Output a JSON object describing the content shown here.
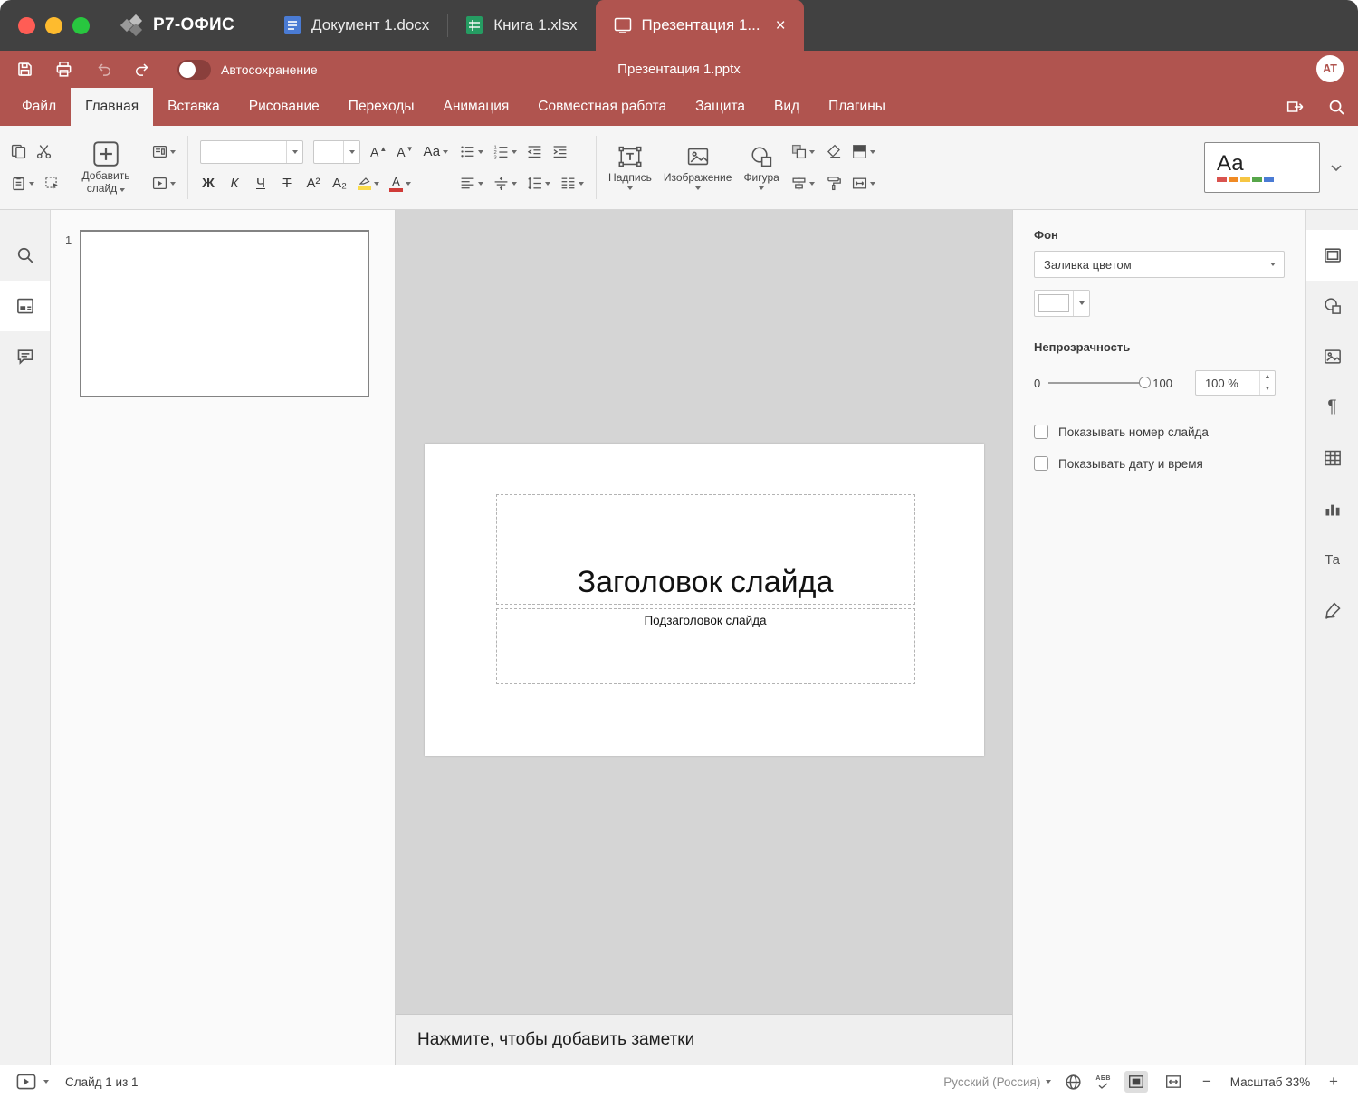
{
  "colors": {
    "accent": "#b0544f",
    "chrome_bar": "#414141",
    "traffic_close": "#ff5d55",
    "traffic_min": "#febb2e",
    "traffic_max": "#28c73f",
    "doc_tab_icon": "#4a7bd4",
    "sheet_tab_icon": "#259c62",
    "canvas_bg": "#d5d5d5",
    "theme_stripe_1": "#d9534f",
    "theme_stripe_2": "#f08a24",
    "theme_stripe_3": "#f6c643",
    "theme_stripe_4": "#57a64a",
    "theme_stripe_5": "#4a7bd4",
    "highlight_bar": "#fadb4a",
    "font_color_bar": "#d03b38"
  },
  "chrome": {
    "app_name": "Р7-ОФИС",
    "tabs": [
      {
        "label": "Документ 1.docx",
        "type": "document"
      },
      {
        "label": "Книга 1.xlsx",
        "type": "spreadsheet"
      },
      {
        "label": "Презентация 1...",
        "type": "presentation",
        "active": true,
        "close_glyph": "×"
      }
    ]
  },
  "titlebar": {
    "autosave_label": "Автосохранение",
    "autosave_on": false,
    "document_title": "Презентация 1.pptx",
    "avatar_initials": "AT"
  },
  "menubar": {
    "items": [
      {
        "label": "Файл"
      },
      {
        "label": "Главная"
      },
      {
        "label": "Вставка"
      },
      {
        "label": "Рисование"
      },
      {
        "label": "Переходы"
      },
      {
        "label": "Анимация"
      },
      {
        "label": "Совместная работа"
      },
      {
        "label": "Защита"
      },
      {
        "label": "Вид"
      },
      {
        "label": "Плагины"
      }
    ],
    "active_item": "Главная"
  },
  "toolbar": {
    "add_slide_label": "Добавить слайд",
    "font_family_value": "",
    "font_size_value": "",
    "bold": "Ж",
    "italic": "К",
    "underline": "Ч",
    "strikethrough": "Т",
    "superscript": "А²",
    "subscript": "А₂",
    "font_color_letter": "А",
    "change_case": "Аа",
    "textbox_label": "Надпись",
    "image_label": "Изображение",
    "shape_label": "Фигура",
    "theme_preview": "Аа"
  },
  "slides_panel": {
    "slide_number": "1"
  },
  "slide": {
    "title_placeholder": "Заголовок слайда",
    "subtitle_placeholder": "Подзаголовок слайда"
  },
  "notes": {
    "placeholder": "Нажмите, чтобы добавить заметки"
  },
  "background_panel": {
    "title": "Фон",
    "fill_type_value": "Заливка цветом",
    "swatch_color": "#ffffff",
    "opacity_label": "Непрозрачность",
    "opacity_min": "0",
    "opacity_max": "100",
    "opacity_value": "100 %",
    "checkbox_slide_number": "Показывать номер слайда",
    "checkbox_slide_number_checked": false,
    "checkbox_date_time": "Показывать дату и время",
    "checkbox_date_time_checked": false
  },
  "statusbar": {
    "slide_counter": "Слайд 1 из 1",
    "language": "Русский (Россия)",
    "spellcheck_glyph": "АБВ",
    "zoom_label": "Масштаб 33%"
  },
  "icons": {
    "paragraph_glyph": "¶",
    "textart_glyph": "Та",
    "named": [
      "save-icon",
      "print-icon",
      "undo-icon",
      "redo-icon",
      "copy-icon",
      "cut-icon",
      "paste-icon",
      "select-icon",
      "add-slide-icon",
      "slide-layout-icon",
      "slide-preview-icon",
      "bullets-icon",
      "numbered-list-icon",
      "decrease-indent-icon",
      "increase-indent-icon",
      "align-icon",
      "vertical-align-icon",
      "line-spacing-icon",
      "columns-icon",
      "textbox-icon",
      "image-icon",
      "shape-icon",
      "arrange-icon",
      "align-shapes-icon",
      "eraser-icon",
      "paint-roller-icon",
      "color-scheme-icon",
      "slide-size-icon",
      "search-icon",
      "slides-panel-icon",
      "comments-icon",
      "share-icon",
      "slide-settings-icon",
      "shape-settings-icon",
      "image-settings-icon",
      "paragraph-settings-icon",
      "table-settings-icon",
      "chart-settings-icon",
      "textart-settings-icon",
      "signature-settings-icon",
      "start-slideshow-icon",
      "globe-icon",
      "spellcheck-icon",
      "fit-slide-icon",
      "fit-width-icon",
      "zoom-out-icon",
      "zoom-in-icon",
      "highlight-icon",
      "font-color-icon"
    ]
  }
}
